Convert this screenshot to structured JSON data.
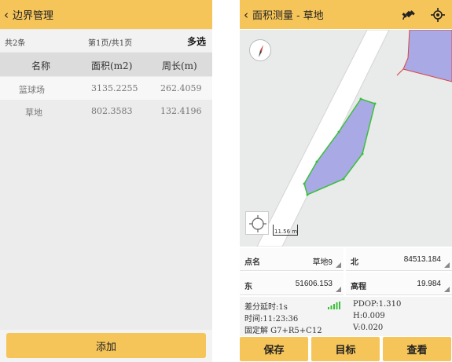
{
  "left": {
    "header": {
      "back_glyph": "‹",
      "title": "边界管理"
    },
    "pager": {
      "count": "共2条",
      "page": "第1页/共1页",
      "multi_select": "多选"
    },
    "table": {
      "headers": [
        "名称",
        "面积(m2)",
        "周长(m)"
      ],
      "rows": [
        [
          "篮球场",
          "3135.2255",
          "262.4059"
        ],
        [
          "草地",
          "802.3583",
          "132.4196"
        ]
      ]
    },
    "add_label": "添加"
  },
  "right": {
    "header": {
      "back_glyph": "‹",
      "title": "面积测量 - 草地",
      "icons": [
        "satellite-icon",
        "gps-target-icon"
      ]
    },
    "map": {
      "scale_label": "11.56 m",
      "icons": [
        "compass-icon",
        "locate-icon"
      ],
      "colors": {
        "road": "#ffffff",
        "polygon_fill": "#a9a9e6",
        "polygon_edge": "#3cbf3c",
        "parcel_edge": "#d64545"
      }
    },
    "fields": {
      "point_name": {
        "label": "点名",
        "value": "草地9"
      },
      "north": {
        "label": "北",
        "value": "84513.184"
      },
      "east": {
        "label": "东",
        "value": "51606.153"
      },
      "elevation": {
        "label": "高程",
        "value": "19.984"
      }
    },
    "status": {
      "diff_delay": "差分延时:1s",
      "pdop": "PDOP:1.310",
      "time": "时间:11:23:36",
      "h": "H:0.009",
      "solution": "固定解  G7+R5+C12",
      "v": "V:0.020"
    },
    "buttons": {
      "save": "保存",
      "target": "目标",
      "view": "查看"
    }
  },
  "colors": {
    "header": "#f6c55a",
    "accent_green": "#3cbf3c"
  }
}
